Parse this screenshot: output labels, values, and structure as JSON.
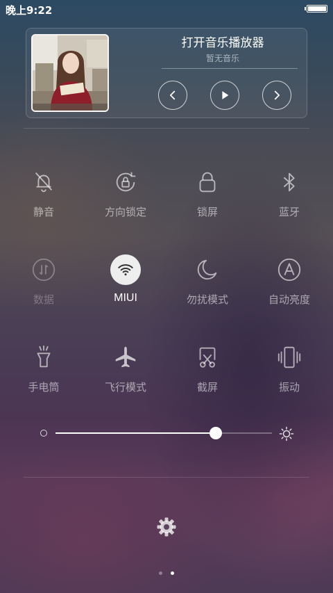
{
  "status_bar": {
    "time": "晚上9:22",
    "battery_icon": "battery-full-icon"
  },
  "music": {
    "title": "打开音乐播放器",
    "subtitle": "暂无音乐",
    "controls": [
      "previous-icon",
      "play-icon",
      "next-icon"
    ]
  },
  "tiles": [
    {
      "label": "静音",
      "icon": "mute-bell-icon",
      "state": "off"
    },
    {
      "label": "方向锁定",
      "icon": "rotation-lock-icon",
      "state": "off"
    },
    {
      "label": "锁屏",
      "icon": "lock-icon",
      "state": "off"
    },
    {
      "label": "蓝牙",
      "icon": "bluetooth-icon",
      "state": "off"
    },
    {
      "label": "数据",
      "icon": "mobile-data-icon",
      "state": "disabled"
    },
    {
      "label": "MIUI",
      "icon": "wifi-icon",
      "state": "on"
    },
    {
      "label": "勿扰模式",
      "icon": "moon-icon",
      "state": "off"
    },
    {
      "label": "自动亮度",
      "icon": "auto-brightness-icon",
      "state": "off"
    },
    {
      "label": "手电筒",
      "icon": "flashlight-icon",
      "state": "off"
    },
    {
      "label": "飞行模式",
      "icon": "airplane-icon",
      "state": "off"
    },
    {
      "label": "截屏",
      "icon": "screenshot-icon",
      "state": "off"
    },
    {
      "label": "振动",
      "icon": "vibrate-icon",
      "state": "off"
    }
  ],
  "brightness": {
    "level": 0.74
  },
  "pager": {
    "total": 2,
    "current": 2
  },
  "colors": {
    "active_tile": "#eeeeee",
    "label": "#ffffff"
  }
}
